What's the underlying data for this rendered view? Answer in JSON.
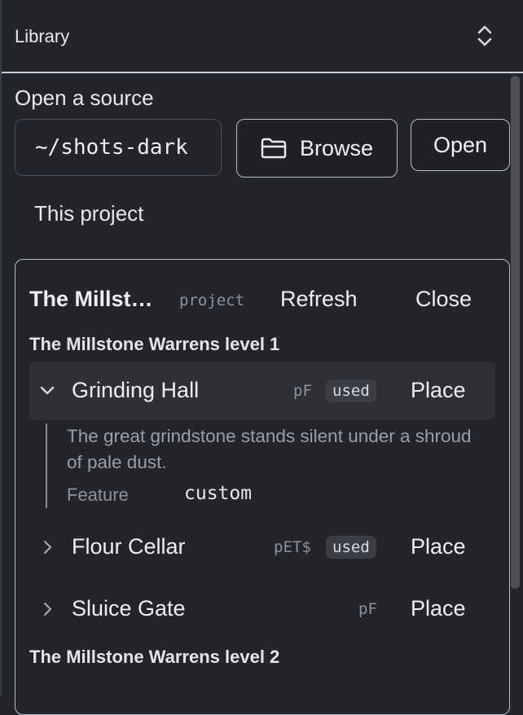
{
  "header": {
    "title": "Library"
  },
  "source": {
    "title": "Open a source",
    "path_value": "~/shots-dark",
    "browse_label": "Browse",
    "open_label": "Open"
  },
  "tab": {
    "label": "This project"
  },
  "project": {
    "name": "The Millst…",
    "tag": "project",
    "refresh_label": "Refresh",
    "close_label": "Close"
  },
  "groups": [
    {
      "title": "The Millstone Warrens level 1",
      "items": [
        {
          "name": "Grinding Hall",
          "code": "pF",
          "badge": "used",
          "place_label": "Place",
          "description": "The great grindstone stands silent under a shroud of pale dust.",
          "field_label": "Feature",
          "field_value": "custom"
        },
        {
          "name": "Flour Cellar",
          "code": "pET$",
          "badge": "used",
          "place_label": "Place"
        },
        {
          "name": "Sluice Gate",
          "code": "pF",
          "place_label": "Place"
        }
      ]
    },
    {
      "title": "The Millstone Warrens level 2",
      "items": []
    }
  ],
  "colors": {
    "background": "#23252b",
    "border": "#b9bcc3",
    "muted_text": "#8d919a",
    "expanded_row": "#2e3036"
  }
}
